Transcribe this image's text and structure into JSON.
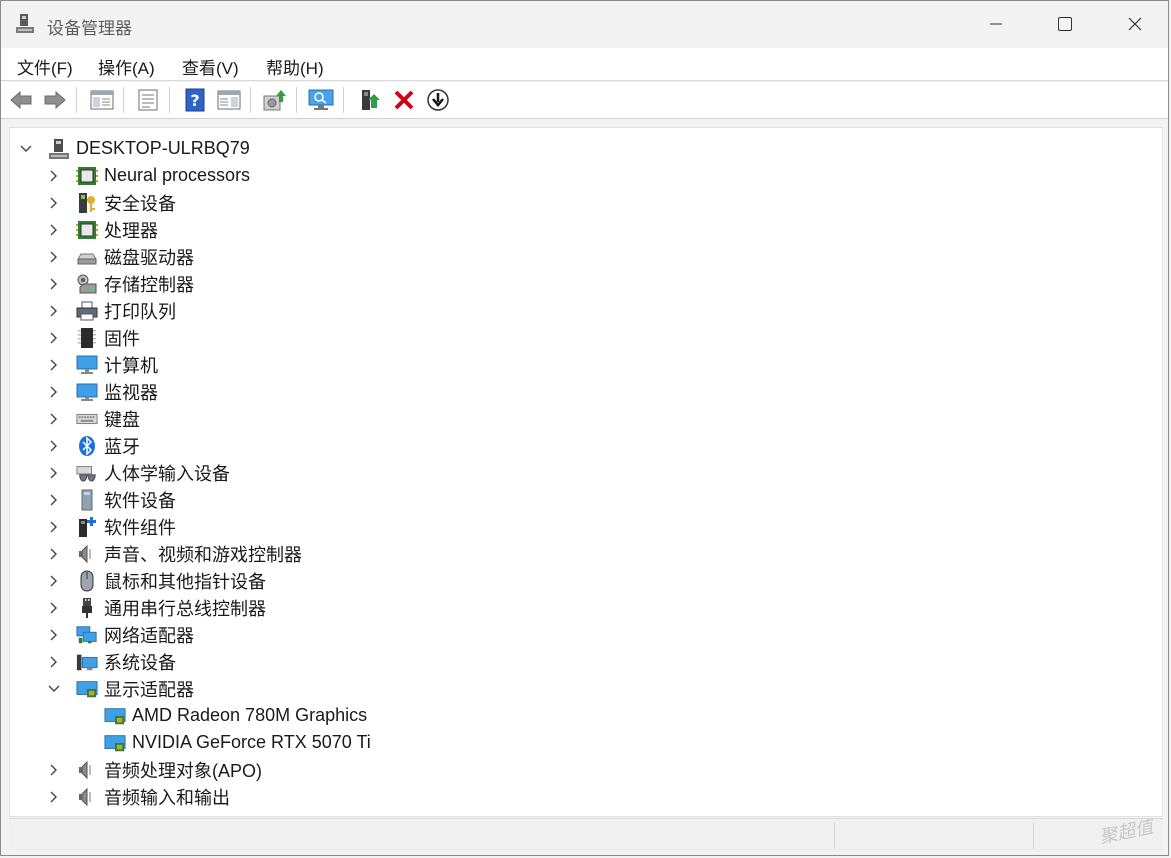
{
  "window": {
    "title": "设备管理器",
    "controls": {
      "minimize": "minimize",
      "maximize": "maximize",
      "close": "close"
    }
  },
  "menubar": {
    "items": [
      "文件(F)",
      "操作(A)",
      "查看(V)",
      "帮助(H)"
    ]
  },
  "toolbar": {
    "buttons": [
      "back-arrow-icon",
      "forward-arrow-icon",
      "show-hide-console-tree-icon",
      "properties-icon",
      "help-icon",
      "action-pane-icon",
      "update-driver-icon",
      "scan-hardware-icon",
      "enable-device-icon",
      "uninstall-device-icon",
      "disable-device-icon"
    ]
  },
  "tree": {
    "root": "DESKTOP-ULRBQ79",
    "categories": [
      {
        "label": "Neural processors",
        "icon": "chip-icon",
        "expanded": false
      },
      {
        "label": "安全设备",
        "icon": "security-device-icon",
        "expanded": false
      },
      {
        "label": "处理器",
        "icon": "cpu-icon",
        "expanded": false
      },
      {
        "label": "磁盘驱动器",
        "icon": "disk-drive-icon",
        "expanded": false
      },
      {
        "label": "存储控制器",
        "icon": "storage-controller-icon",
        "expanded": false
      },
      {
        "label": "打印队列",
        "icon": "printer-icon",
        "expanded": false
      },
      {
        "label": "固件",
        "icon": "firmware-icon",
        "expanded": false
      },
      {
        "label": "计算机",
        "icon": "computer-icon",
        "expanded": false
      },
      {
        "label": "监视器",
        "icon": "monitor-icon",
        "expanded": false
      },
      {
        "label": "键盘",
        "icon": "keyboard-icon",
        "expanded": false
      },
      {
        "label": "蓝牙",
        "icon": "bluetooth-icon",
        "expanded": false
      },
      {
        "label": "人体学输入设备",
        "icon": "hid-icon",
        "expanded": false
      },
      {
        "label": "软件设备",
        "icon": "software-device-icon",
        "expanded": false
      },
      {
        "label": "软件组件",
        "icon": "software-component-icon",
        "expanded": false
      },
      {
        "label": "声音、视频和游戏控制器",
        "icon": "speaker-icon",
        "expanded": false
      },
      {
        "label": "鼠标和其他指针设备",
        "icon": "mouse-icon",
        "expanded": false
      },
      {
        "label": "通用串行总线控制器",
        "icon": "usb-icon",
        "expanded": false
      },
      {
        "label": "网络适配器",
        "icon": "network-adapter-icon",
        "expanded": false
      },
      {
        "label": "系统设备",
        "icon": "system-device-icon",
        "expanded": false
      },
      {
        "label": "显示适配器",
        "icon": "display-adapter-icon",
        "expanded": true,
        "children": [
          "AMD Radeon 780M Graphics",
          "NVIDIA GeForce RTX 5070 Ti"
        ]
      },
      {
        "label": "音频处理对象(APO)",
        "icon": "speaker-icon",
        "expanded": false
      },
      {
        "label": "音频输入和输出",
        "icon": "speaker-icon",
        "expanded": false
      }
    ]
  },
  "watermark": "聚超值",
  "colors": {
    "accent_blue": "#1e6fd9",
    "close_red": "#d0021b",
    "green_arrow": "#2f9e44"
  }
}
